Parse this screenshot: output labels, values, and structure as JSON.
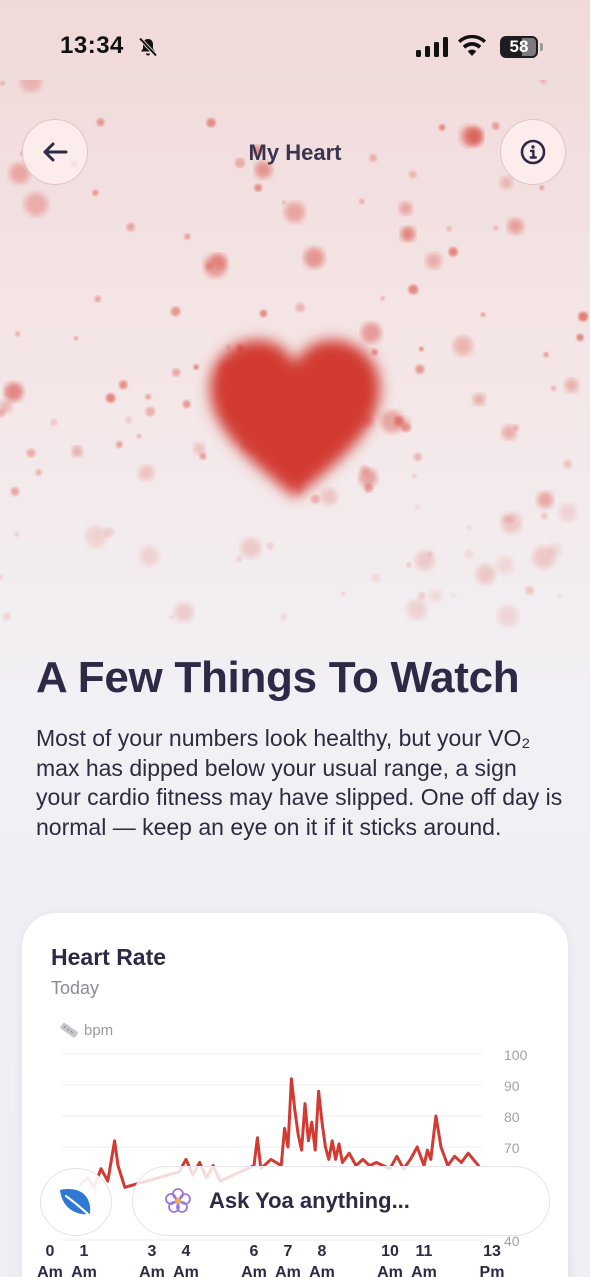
{
  "status_bar": {
    "time": "13:34",
    "battery": "58"
  },
  "header": {
    "title": "My Heart",
    "back_icon": "arrow-left-icon",
    "info_icon": "info-circle-icon"
  },
  "hero": {
    "icon": "heart-icon",
    "accent_color": "#d23a32"
  },
  "summary": {
    "headline": "A Few Things To Watch",
    "body": "Most of your numbers look healthy, but your VO₂ max has dipped below your usual range, a sign your cardio fitness may have slipped. One off day is normal — keep an eye on it if it sticks around."
  },
  "heart_rate_card": {
    "title": "Heart Rate",
    "subtitle": "Today",
    "unit": "bpm",
    "unit_icon": "ruler-icon"
  },
  "chart_data": {
    "type": "line",
    "series_color": "#d23a32",
    "ylim": [
      40,
      100
    ],
    "y_ticks": [
      "100",
      "90",
      "80",
      "70",
      "40"
    ],
    "x_ticks": [
      {
        "hour": 0,
        "top": "0",
        "bottom": "Am"
      },
      {
        "hour": 1,
        "top": "1",
        "bottom": "Am"
      },
      {
        "hour": 3,
        "top": "3",
        "bottom": "Am"
      },
      {
        "hour": 4,
        "top": "4",
        "bottom": "Am"
      },
      {
        "hour": 6,
        "top": "6",
        "bottom": "Am"
      },
      {
        "hour": 7,
        "top": "7",
        "bottom": "Am"
      },
      {
        "hour": 8,
        "top": "8",
        "bottom": "Am"
      },
      {
        "hour": 10,
        "top": "10",
        "bottom": "Am"
      },
      {
        "hour": 11,
        "top": "11",
        "bottom": "Am"
      },
      {
        "hour": 13,
        "top": "13",
        "bottom": "Pm"
      }
    ],
    "points": [
      [
        0.9,
        58
      ],
      [
        1.1,
        60
      ],
      [
        1.3,
        57
      ],
      [
        1.5,
        63
      ],
      [
        1.7,
        59
      ],
      [
        1.9,
        72
      ],
      [
        2.0,
        64
      ],
      [
        2.2,
        57
      ],
      [
        3.8,
        62
      ],
      [
        4.0,
        66
      ],
      [
        4.2,
        61
      ],
      [
        4.4,
        65
      ],
      [
        4.6,
        60
      ],
      [
        4.8,
        64
      ],
      [
        5.0,
        59
      ],
      [
        6.0,
        64
      ],
      [
        6.1,
        73
      ],
      [
        6.2,
        63
      ],
      [
        6.5,
        66
      ],
      [
        6.8,
        64
      ],
      [
        6.9,
        76
      ],
      [
        7.0,
        70
      ],
      [
        7.1,
        92
      ],
      [
        7.2,
        82
      ],
      [
        7.3,
        74
      ],
      [
        7.4,
        69
      ],
      [
        7.5,
        84
      ],
      [
        7.6,
        72
      ],
      [
        7.7,
        78
      ],
      [
        7.8,
        69
      ],
      [
        7.9,
        88
      ],
      [
        8.0,
        78
      ],
      [
        8.1,
        70
      ],
      [
        8.2,
        66
      ],
      [
        8.3,
        72
      ],
      [
        8.4,
        66
      ],
      [
        8.5,
        71
      ],
      [
        8.6,
        65
      ],
      [
        8.8,
        68
      ],
      [
        9.0,
        64
      ],
      [
        9.2,
        66
      ],
      [
        9.4,
        64
      ],
      [
        9.6,
        65
      ],
      [
        10.0,
        63
      ],
      [
        10.2,
        67
      ],
      [
        10.4,
        63
      ],
      [
        10.6,
        66
      ],
      [
        10.8,
        70
      ],
      [
        11.0,
        64
      ],
      [
        11.1,
        69
      ],
      [
        11.2,
        66
      ],
      [
        11.35,
        80
      ],
      [
        11.5,
        70
      ],
      [
        11.7,
        64
      ],
      [
        11.9,
        67
      ],
      [
        12.1,
        65
      ],
      [
        12.3,
        68
      ],
      [
        12.6,
        64
      ]
    ]
  },
  "dock": {
    "leaf_icon": "leaf-icon",
    "ask_icon": "flower-sparkle-icon",
    "ask_placeholder": "Ask Yoa anything..."
  }
}
